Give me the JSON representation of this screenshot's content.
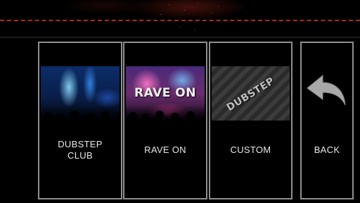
{
  "menu": {
    "cards": [
      {
        "id": "dubstep-club",
        "label": "DUBSTEP\nCLUB",
        "thumb_icon": "club-lights-image"
      },
      {
        "id": "rave-on",
        "label": "RAVE ON",
        "thumb_text": "RAVE ON",
        "thumb_icon": "rave-crowd-image"
      },
      {
        "id": "custom",
        "label": "CUSTOM",
        "thumb_text": "DUBSTEP",
        "thumb_icon": "dubstep-logo-image"
      },
      {
        "id": "back",
        "label": "BACK",
        "thumb_icon": "back-arrow-icon"
      }
    ]
  },
  "colors": {
    "background": "#000000",
    "card_border": "#8f8f8f",
    "accent_line": "#c8322a",
    "label_text": "#e8e8e8"
  }
}
